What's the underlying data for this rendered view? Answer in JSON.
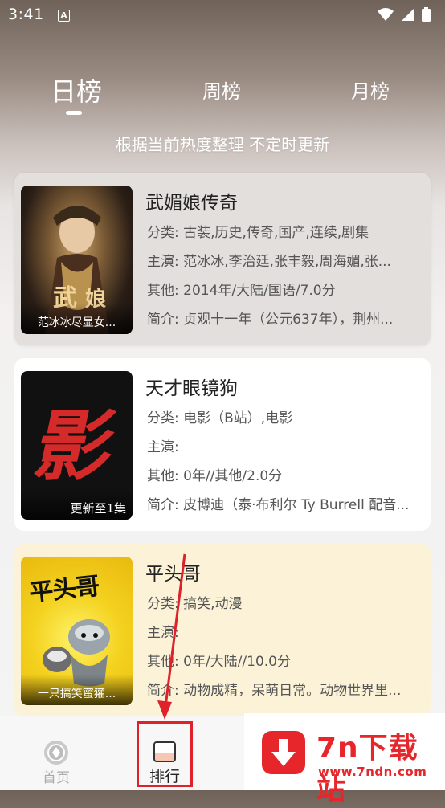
{
  "status": {
    "time": "3:41",
    "a_badge": "A"
  },
  "tabs": [
    {
      "label": "日榜",
      "active": true
    },
    {
      "label": "周榜",
      "active": false
    },
    {
      "label": "月榜",
      "active": false
    }
  ],
  "subtitle": "根据当前热度整理 不定时更新",
  "cards": [
    {
      "title": "武媚娘传奇",
      "thumb_caption": "范冰冰尽显女...",
      "category": "分类:  古装,历史,传奇,国产,连续,剧集",
      "cast": "主演:  范冰冰,李治廷,张丰毅,周海媚,张...",
      "other": "其他:  2014年/大陆/国语/7.0分",
      "intro": "简介:  贞观十一年（公元637年），荆州..."
    },
    {
      "title": "天才眼镜狗",
      "thumb_caption": "更新至1集",
      "thumb_glyph": "影",
      "category": "分类:  电影（B站）,电影",
      "cast": "主演:",
      "other": "其他:  0年//其他/2.0分",
      "intro": "简介:  皮博迪（泰·布利尔 Ty Burrell 配音..."
    },
    {
      "title": "平头哥",
      "thumb_caption": "一只搞笑蜜獾...",
      "thumb_glyph": "平头哥",
      "category": "分类:  搞笑,动漫",
      "cast": "主演:",
      "other": "其他:  0年/大陆//10.0分",
      "intro": "简介:  动物成精，呆萌日常。动物世界里..."
    }
  ],
  "nav": {
    "home": "首页",
    "rank": "排行"
  },
  "watermark": {
    "title": "7n下载站",
    "url": "www.7ndn.com"
  },
  "colors": {
    "accent": "#e0202a",
    "card3_bg": "#fbf2d8"
  }
}
